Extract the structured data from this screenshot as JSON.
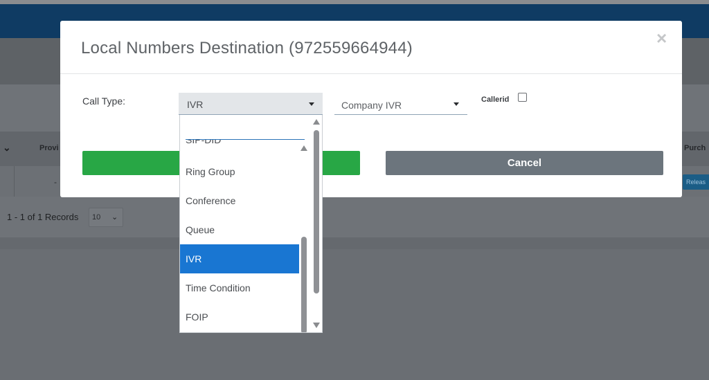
{
  "background": {
    "table_header": {
      "provider_label": "Provi",
      "purchase_label": "Purch"
    },
    "row_placeholder": "-",
    "release_button": "Releas",
    "pagination": {
      "records": "1 - 1 of 1 Records",
      "page_size": "10"
    }
  },
  "modal": {
    "title": "Local Numbers Destination (972559664944)",
    "close_icon": "×",
    "form": {
      "call_type_label": "Call Type:",
      "call_type_value": "IVR",
      "destination_value": "Company IVR",
      "callerid_label": "Callerid",
      "callerid_checked": false
    },
    "buttons": {
      "save_label": "",
      "cancel_label": "Cancel"
    }
  },
  "dropdown": {
    "search_value": "",
    "items": [
      {
        "label": "SIP-DID",
        "selected": false
      },
      {
        "label": "Ring Group",
        "selected": false
      },
      {
        "label": "Conference",
        "selected": false
      },
      {
        "label": "Queue",
        "selected": false
      },
      {
        "label": "IVR",
        "selected": true
      },
      {
        "label": "Time Condition",
        "selected": false
      },
      {
        "label": "FOIP",
        "selected": false
      }
    ]
  },
  "colors": {
    "navbar": "#0f3b63",
    "selected_item": "#1976d2",
    "save_button": "#28a745",
    "cancel_button": "#6c757d"
  }
}
